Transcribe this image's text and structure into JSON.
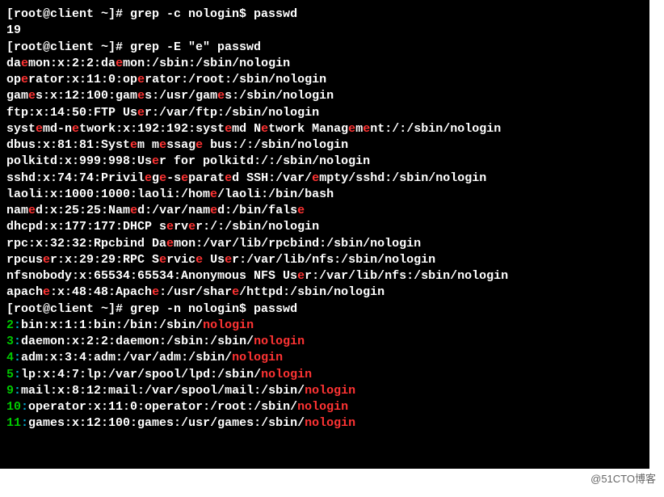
{
  "prompt": "[root@client ~]# ",
  "cmd1": "grep -c nologin$ passwd",
  "out1": "19",
  "cmd2": "grep -E \"e\" passwd",
  "cmd3": "grep -n nologin$ passwd",
  "watermark": "@51CTO博客",
  "hl_lines": [
    "da|e|mon:x:2:2:da|e|mon:/sbin:/sbin/nologin",
    "op|e|rator:x:11:0:op|e|rator:/root:/sbin/nologin",
    "gam|e|s:x:12:100:gam|e|s:/usr/gam|e|s:/sbin/nologin",
    "ftp:x:14:50:FTP Us|e|r:/var/ftp:/sbin/nologin",
    "syst|e|md-n|e|twork:x:192:192:syst|e|md N|e|twork Manag|e|m|e|nt:/:/sbin/nologin",
    "dbus:x:81:81:Syst|e|m m|e|ssag|e| bus:/:/sbin/nologin",
    "polkitd:x:999:998:Us|e|r for polkitd:/:/sbin/nologin",
    "sshd:x:74:74:Privil|e|g|e|-s|e|parat|e|d SSH:/var/|e|mpty/sshd:/sbin/nologin",
    "laoli:x:1000:1000:laoli:/hom|e|/laoli:/bin/bash",
    "nam|e|d:x:25:25:Nam|e|d:/var/nam|e|d:/bin/fals|e|",
    "dhcpd:x:177:177:DHCP s|e|rv|e|r:/:/sbin/nologin",
    "rpc:x:32:32:Rpcbind Da|e|mon:/var/lib/rpcbind:/sbin/nologin",
    "rpcus|e|r:x:29:29:RPC S|e|rvic|e| Us|e|r:/var/lib/nfs:/sbin/nologin",
    "nfsnobody:x:65534:65534:Anonymous NFS Us|e|r:/var/lib/nfs:/sbin/nologin",
    "apach|e|:x:48:48:Apach|e|:/usr/shar|e|/httpd:/sbin/nologin"
  ],
  "num_lines": [
    {
      "n": "2",
      "body": "bin:x:1:1:bin:/bin:/sbin/",
      "match": "nologin"
    },
    {
      "n": "3",
      "body": "daemon:x:2:2:daemon:/sbin:/sbin/",
      "match": "nologin"
    },
    {
      "n": "4",
      "body": "adm:x:3:4:adm:/var/adm:/sbin/",
      "match": "nologin"
    },
    {
      "n": "5",
      "body": "lp:x:4:7:lp:/var/spool/lpd:/sbin/",
      "match": "nologin"
    },
    {
      "n": "9",
      "body": "mail:x:8:12:mail:/var/spool/mail:/sbin/",
      "match": "nologin"
    },
    {
      "n": "10",
      "body": "operator:x:11:0:operator:/root:/sbin/",
      "match": "nologin"
    },
    {
      "n": "11",
      "body": "games:x:12:100:games:/usr/games:/sbin/",
      "match": "nologin"
    }
  ]
}
